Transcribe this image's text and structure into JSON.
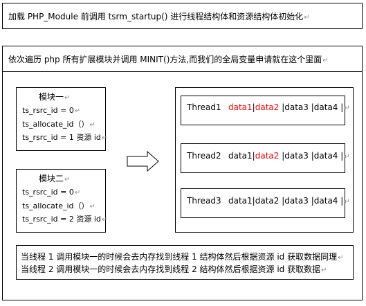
{
  "header": {
    "line1": "加载 PHP_Module 前调用 tsrm_startup() 进行线程结构体和资源结构体初始化",
    "line2": "依次遍历 php 所有扩展模块并调用 MINIT()方法,而我们的全局变量申请就在这个里面"
  },
  "para_mark": "↵",
  "modules": [
    {
      "title": "模块一",
      "lines": [
        "ts_rsrc_id = 0",
        "ts_allocate_id（）",
        "ts_rsrc_id = 1 资源 id"
      ]
    },
    {
      "title": "模块二",
      "lines": [
        "ts_rsrc_id = 0",
        "ts_allocate_id（）",
        "ts_rsrc_id = 2 资源 id"
      ]
    }
  ],
  "threads": [
    {
      "name": "Thread1",
      "cells": [
        {
          "text": "data1",
          "color": "#ff0000"
        },
        {
          "text": "data2",
          "color": "#ff0000"
        },
        {
          "text": "data3",
          "color": "#000000"
        },
        {
          "text": "data4",
          "color": "#000000"
        }
      ]
    },
    {
      "name": "Thread2",
      "cells": [
        {
          "text": "data1",
          "color": "#000000"
        },
        {
          "text": "data2",
          "color": "#ff0000"
        },
        {
          "text": "data3",
          "color": "#000000"
        },
        {
          "text": "data4",
          "color": "#000000"
        }
      ]
    },
    {
      "name": "Thread3",
      "cells": [
        {
          "text": "data1",
          "color": "#000000"
        },
        {
          "text": "data2",
          "color": "#000000"
        },
        {
          "text": "data3",
          "color": "#000000"
        },
        {
          "text": "data4",
          "color": "#000000"
        }
      ]
    }
  ],
  "footer": {
    "line1": "当线程 1 调用模块一的时候会去内存找到线程 1 结构体然后根据资源 id 获取数据同理",
    "line2": "当线程 2 调用模块一的时候会去内存找到线程 2 结构体然后根据资源 id 获取数据"
  }
}
